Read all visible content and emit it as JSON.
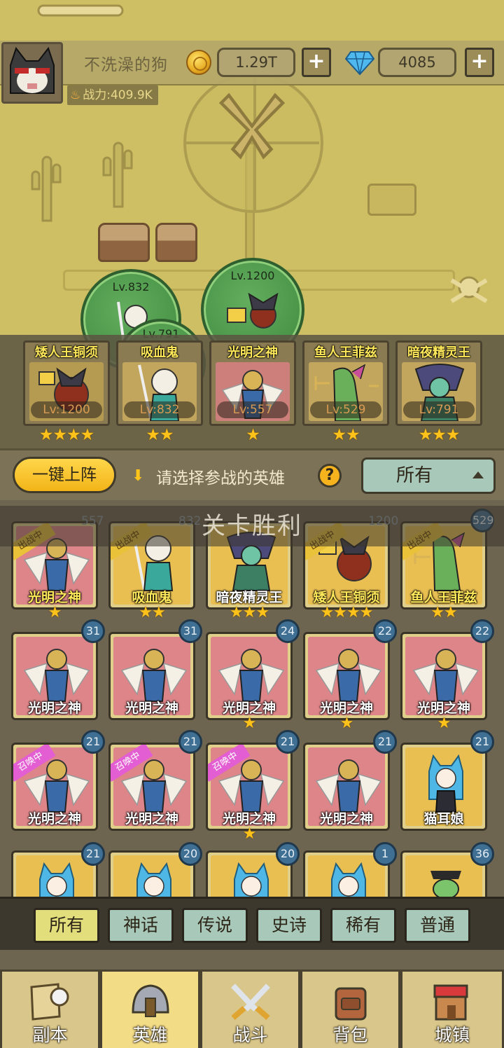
{
  "player": {
    "name": "不洗澡的狗",
    "power": "战力:409.9K"
  },
  "resources": {
    "gold": "1.29T",
    "gems": "4085"
  },
  "map_heroes": [
    {
      "level": "Lv.832"
    },
    {
      "level": "Lv.1200"
    },
    {
      "level": "Lv.791"
    }
  ],
  "formation": [
    {
      "name": "矮人王铜须",
      "level": "Lv:1200",
      "stars": "★★★★"
    },
    {
      "name": "吸血鬼",
      "level": "Lv:832",
      "stars": "★★"
    },
    {
      "name": "光明之神",
      "level": "Lv:557",
      "stars": "★"
    },
    {
      "name": "鱼人王菲兹",
      "level": "Lv:529",
      "stars": "★★"
    },
    {
      "name": "暗夜精灵王",
      "level": "Lv:791",
      "stars": "★★★"
    }
  ],
  "controls": {
    "auto_deploy": "一键上阵",
    "hint": "请选择参战的英雄",
    "help": "?",
    "filter_selected": "所有"
  },
  "toast": "关卡胜利",
  "hero_list": [
    {
      "name": "光明之神",
      "level": "557",
      "tag": "出战中",
      "stars": "★"
    },
    {
      "name": "吸血鬼",
      "level": "832",
      "tag": "出战中",
      "stars": "★★"
    },
    {
      "name": "暗夜精灵王",
      "level": "",
      "tag": "",
      "stars": "★★★"
    },
    {
      "name": "矮人王铜须",
      "level": "1200",
      "tag": "出战中",
      "stars": "★★★★"
    },
    {
      "name": "鱼人王菲兹",
      "level": "529",
      "tag": "出战中",
      "stars": "★★"
    },
    {
      "name": "光明之神",
      "level": "31",
      "tag": "",
      "stars": ""
    },
    {
      "name": "光明之神",
      "level": "31",
      "tag": "",
      "stars": ""
    },
    {
      "name": "光明之神",
      "level": "24",
      "tag": "",
      "stars": "★"
    },
    {
      "name": "光明之神",
      "level": "22",
      "tag": "",
      "stars": "★"
    },
    {
      "name": "光明之神",
      "level": "22",
      "tag": "",
      "stars": "★"
    },
    {
      "name": "光明之神",
      "level": "21",
      "tag": "召唤中",
      "stars": ""
    },
    {
      "name": "光明之神",
      "level": "21",
      "tag": "召唤中",
      "stars": ""
    },
    {
      "name": "光明之神",
      "level": "21",
      "tag": "召唤中",
      "stars": "★"
    },
    {
      "name": "光明之神",
      "level": "21",
      "tag": "",
      "stars": ""
    },
    {
      "name": "猫耳娘",
      "level": "21",
      "tag": "",
      "stars": ""
    },
    {
      "name": "",
      "level": "21",
      "tag": "",
      "stars": ""
    },
    {
      "name": "",
      "level": "20",
      "tag": "",
      "stars": ""
    },
    {
      "name": "",
      "level": "20",
      "tag": "",
      "stars": ""
    },
    {
      "name": "",
      "level": "1",
      "tag": "",
      "stars": ""
    },
    {
      "name": "",
      "level": "36",
      "tag": "",
      "stars": ""
    }
  ],
  "rarity_filters": [
    "所有",
    "神话",
    "传说",
    "史诗",
    "稀有",
    "普通"
  ],
  "nav": [
    "副本",
    "英雄",
    "战斗",
    "背包",
    "城镇"
  ],
  "colors": {
    "accent_yellow": "#f2b418",
    "panel": "#6e6551",
    "filter_teal": "#a8c9ba",
    "star": "#ffc21a"
  }
}
